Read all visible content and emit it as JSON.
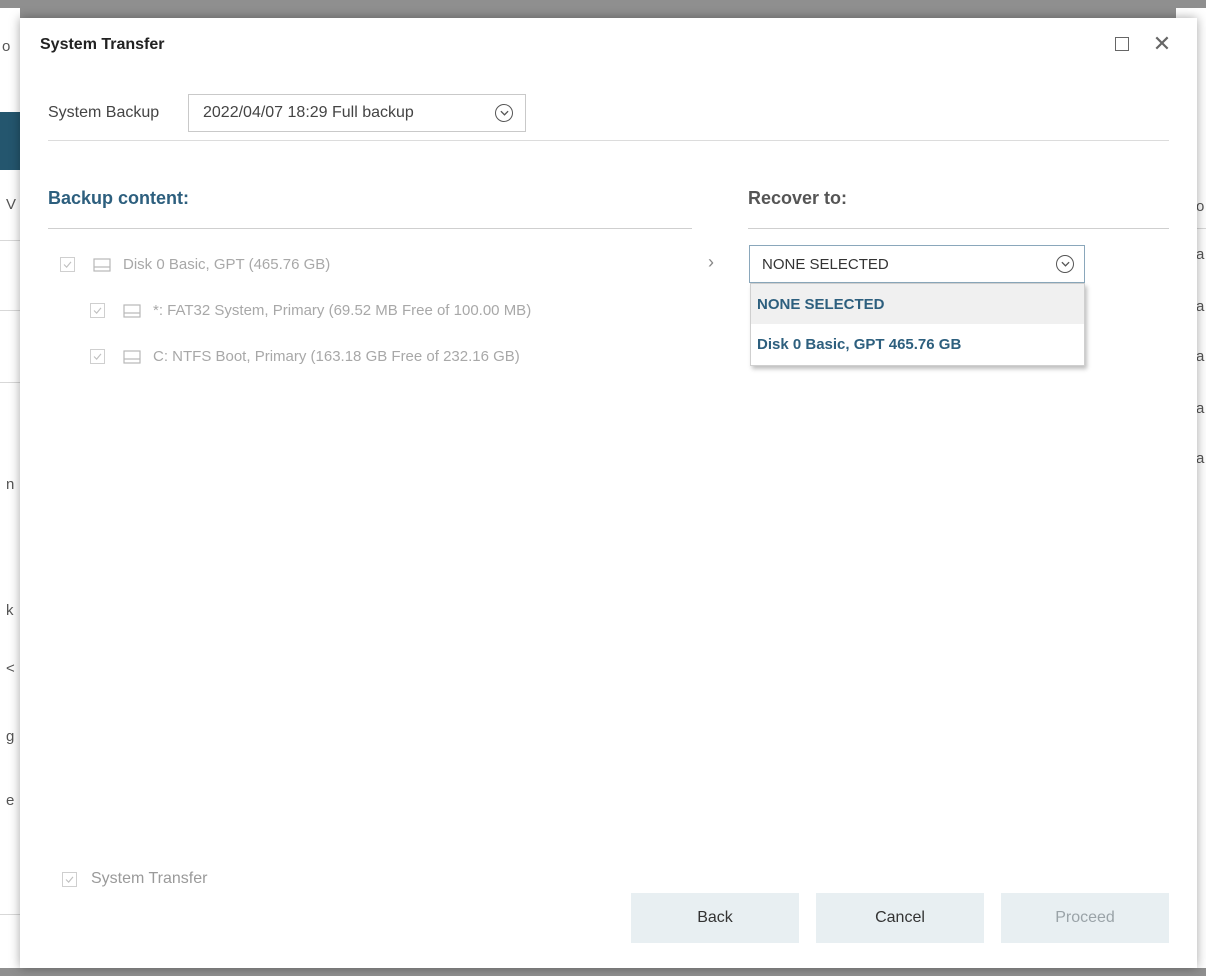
{
  "background": {
    "left_fragments": [
      "o",
      "V",
      "n",
      "k",
      "<",
      "g",
      "e"
    ],
    "right_fragments": [
      "o",
      "a",
      "a",
      "a",
      "a",
      "a"
    ]
  },
  "dialog": {
    "title": "System Transfer",
    "maximize_icon": "maximize-icon",
    "close_icon": "close-icon",
    "close_glyph": "✕",
    "system_backup": {
      "label": "System Backup",
      "value": "2022/04/07 18:29 Full backup"
    },
    "backup_content": {
      "title": "Backup content:",
      "items": [
        {
          "label": "Disk 0 Basic, GPT (465.76 GB)",
          "checked": true,
          "level": 0
        },
        {
          "label": "*: FAT32 System, Primary (69.52 MB Free of 100.00 MB)",
          "checked": true,
          "level": 1
        },
        {
          "label": "C: NTFS Boot, Primary (163.18 GB Free of 232.16 GB)",
          "checked": true,
          "level": 1
        }
      ]
    },
    "arrow_glyph": "›",
    "recover_to": {
      "title": "Recover to:",
      "value": "NONE SELECTED",
      "options": [
        "NONE SELECTED",
        "Disk 0 Basic, GPT 465.76 GB"
      ]
    },
    "footer": {
      "system_transfer_label": "System Transfer",
      "back_label": "Back",
      "cancel_label": "Cancel",
      "proceed_label": "Proceed"
    }
  },
  "colors": {
    "accent": "#2d5f7e",
    "button_bg": "#e8eff2",
    "disabled_text": "#a8a8a8"
  }
}
